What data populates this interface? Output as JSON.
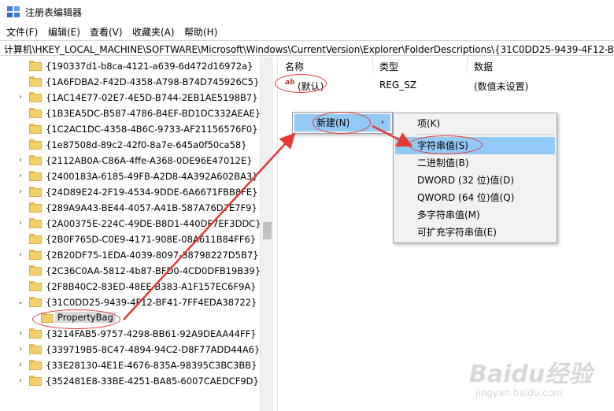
{
  "window": {
    "title": "注册表编辑器",
    "icon": "regedit-icon"
  },
  "menu": [
    {
      "label": "文件(F)"
    },
    {
      "label": "编辑(E)"
    },
    {
      "label": "查看(V)"
    },
    {
      "label": "收藏夹(A)"
    },
    {
      "label": "帮助(H)"
    }
  ],
  "address": "计算机\\HKEY_LOCAL_MACHINE\\SOFTWARE\\Microsoft\\Windows\\CurrentVersion\\Explorer\\FolderDescriptions\\{31C0DD25-9439-4F12-B",
  "tree": [
    {
      "label": "{190337d1-b8ca-4121-a639-6d472d16972a}",
      "expander": ""
    },
    {
      "label": "{1A6FDBA2-F42D-4358-A798-B74D745926C5}",
      "expander": ""
    },
    {
      "label": "{1AC14E77-02E7-4E5D-B744-2EB1AE5198B7}",
      "expander": "›"
    },
    {
      "label": "{1B3EA5DC-B587-4786-B4EF-BD1DC332AEAE}",
      "expander": ""
    },
    {
      "label": "{1C2AC1DC-4358-4B6C-9733-AF21156576F0}",
      "expander": ""
    },
    {
      "label": "{1e87508d-89c2-42f0-8a7e-645a0f50ca58}",
      "expander": ""
    },
    {
      "label": "{2112AB0A-C86A-4ffe-A368-0DE96E47012E}",
      "expander": "›"
    },
    {
      "label": "{2400183A-6185-49FB-A2D8-4A392A602BA3}",
      "expander": "›"
    },
    {
      "label": "{24D89E24-2F19-4534-9DDE-6A6671FBB8FE}",
      "expander": "›"
    },
    {
      "label": "{289A9A43-BE44-4057-A41B-587A76D7E7F9}",
      "expander": ""
    },
    {
      "label": "{2A00375E-224C-49DE-B8D1-440DF7EF3DDC}",
      "expander": "›"
    },
    {
      "label": "{2B0F765D-C0E9-4171-908E-08A611B84FF6}",
      "expander": ""
    },
    {
      "label": "{2B20DF75-1EDA-4039-8097-38798227D5B7}",
      "expander": "›"
    },
    {
      "label": "{2C36C0AA-5812-4b87-BFD0-4CD0DFB19B39}",
      "expander": ""
    },
    {
      "label": "{2F8B40C2-83ED-48EE-B383-A1F157EC6F9A}",
      "expander": ""
    },
    {
      "label": "{31C0DD25-9439-4F12-BF41-7FF4EDA38722}",
      "expander": "⌄"
    },
    {
      "label": "PropertyBag",
      "expander": "",
      "child": true,
      "selected": true
    },
    {
      "label": "{3214FAB5-9757-4298-BB61-92A9DEAA44FF}",
      "expander": "›"
    },
    {
      "label": "{339719B5-8C47-4894-94C2-D8F77ADD44A6}",
      "expander": "›"
    },
    {
      "label": "{33E28130-4E1E-4676-835A-98395C3BC3BB}",
      "expander": "›"
    },
    {
      "label": "{352481E8-33BE-4251-BA85-6007CAEDCF9D}",
      "expander": "›"
    }
  ],
  "values": {
    "headers": {
      "name": "名称",
      "type": "类型",
      "data": "数据"
    },
    "rows": [
      {
        "name": "(默认)",
        "type": "REG_SZ",
        "data": "(数值未设置)",
        "icon": "ab-string-icon"
      }
    ]
  },
  "context_menu": {
    "new_label": "新建(N)",
    "submenu": [
      {
        "label": "项(K)"
      },
      {
        "label": "字符串值(S)",
        "highlighted": true
      },
      {
        "label": "二进制值(B)"
      },
      {
        "label": "DWORD (32 位)值(D)"
      },
      {
        "label": "QWORD (64 位)值(Q)"
      },
      {
        "label": "多字符串值(M)"
      },
      {
        "label": "可扩充字符串值(E)"
      }
    ]
  },
  "watermark": {
    "main": "Baidu经验",
    "sub": "jingyan.baidu.com"
  },
  "colors": {
    "highlight": "#91c9f7",
    "annotation": "#e53935",
    "folder": "#f4ce6b"
  }
}
